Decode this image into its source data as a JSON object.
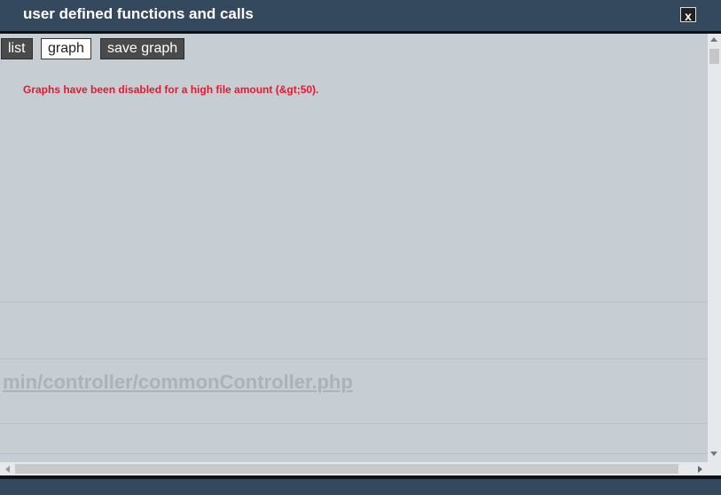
{
  "window": {
    "title": "user defined functions and calls",
    "close_label": "x"
  },
  "toolbar": {
    "list_label": "list",
    "graph_label": "graph",
    "save_graph_label": "save graph"
  },
  "message": {
    "text": "Graphs have been disabled for a high file amount (&gt;50).",
    "color": "#e8172d"
  },
  "background": {
    "path_text": "min/controller/commonController.php"
  },
  "colors": {
    "titlebar": "#34495e",
    "content_bg": "#c6ced4"
  }
}
